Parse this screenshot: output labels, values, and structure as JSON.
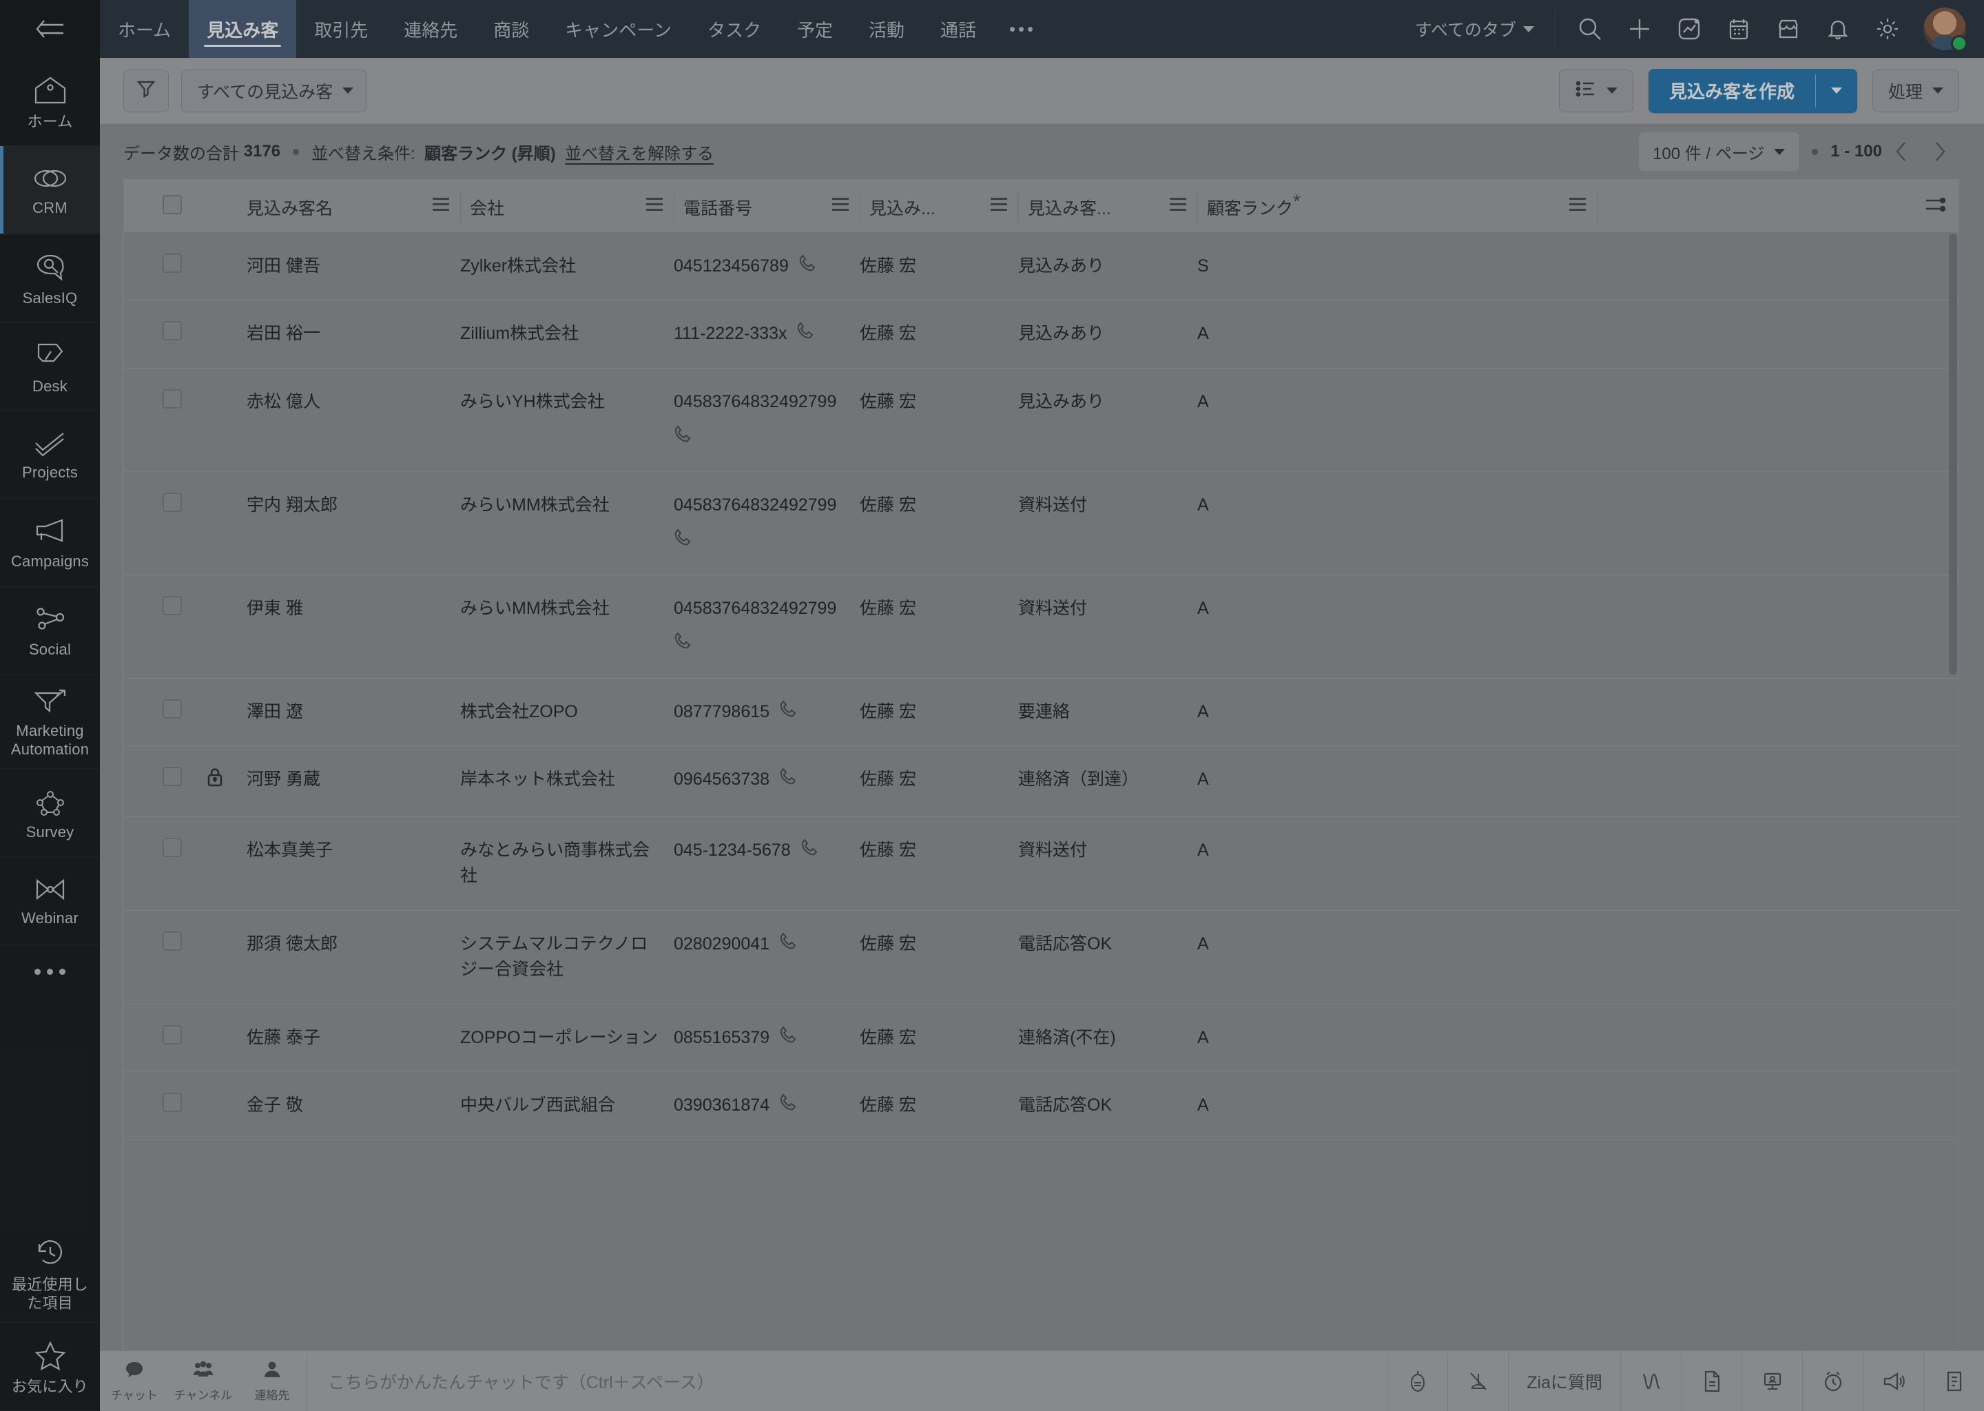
{
  "rail": {
    "collapse_icon": "collapse-arrow-icon",
    "items": [
      {
        "label": "ホーム",
        "icon": "home-icon",
        "active": false
      },
      {
        "label": "CRM",
        "icon": "crm-link-icon",
        "active": true
      },
      {
        "label": "SalesIQ",
        "icon": "salesiq-icon",
        "active": false
      },
      {
        "label": "Desk",
        "icon": "desk-icon",
        "active": false
      },
      {
        "label": "Projects",
        "icon": "projects-check-icon",
        "active": false
      },
      {
        "label": "Campaigns",
        "icon": "campaigns-megaphone-icon",
        "active": false
      },
      {
        "label": "Social",
        "icon": "social-share-icon",
        "active": false
      },
      {
        "label": "Marketing Automation",
        "icon": "marketing-funnel-icon",
        "active": false
      },
      {
        "label": "Survey",
        "icon": "survey-icon",
        "active": false
      },
      {
        "label": "Webinar",
        "icon": "webinar-icon",
        "active": false
      }
    ],
    "more_icon": "more-dots-icon",
    "bottom_items": [
      {
        "label": "最近使用した項目",
        "icon": "recent-clock-icon"
      },
      {
        "label": "お気に入り",
        "icon": "favorite-star-icon"
      }
    ]
  },
  "topnav": {
    "tabs": [
      {
        "label": "ホーム",
        "active": false
      },
      {
        "label": "見込み客",
        "active": true
      },
      {
        "label": "取引先",
        "active": false
      },
      {
        "label": "連絡先",
        "active": false
      },
      {
        "label": "商談",
        "active": false
      },
      {
        "label": "キャンペーン",
        "active": false
      },
      {
        "label": "タスク",
        "active": false
      },
      {
        "label": "予定",
        "active": false
      },
      {
        "label": "活動",
        "active": false
      },
      {
        "label": "通話",
        "active": false
      }
    ],
    "more_tabs_icon": "more-dots-icon",
    "all_tabs_label": "すべてのタブ",
    "icons": [
      "search-icon",
      "plus-icon",
      "analytics-icon",
      "calendar-icon",
      "marketplace-icon",
      "bell-icon",
      "gear-icon"
    ],
    "avatar": "user-avatar",
    "avatar_status": "online"
  },
  "actionbar": {
    "filter_icon": "filter-icon",
    "view_label": "すべての見込み客",
    "list_view_icon": "list-view-icon",
    "create_label": "見込み客を作成",
    "create_color": "#1a6fad",
    "actions_label": "処理"
  },
  "infobar": {
    "total_prefix": "データ数の合計",
    "total_count": "3176",
    "sort_prefix": "並べ替え条件:",
    "sort_field": "顧客ランク (昇順)",
    "clear_sort": "並べ替えを解除する",
    "per_page": "100 件 / ページ",
    "range": "1 - 100",
    "prev_icon": "chevron-left-icon",
    "next_icon": "chevron-right-icon"
  },
  "table": {
    "columns": [
      {
        "key": "select",
        "label": ""
      },
      {
        "key": "name",
        "label": "見込み客名"
      },
      {
        "key": "company",
        "label": "会社"
      },
      {
        "key": "phone",
        "label": "電話番号"
      },
      {
        "key": "owner",
        "label": "見込み..."
      },
      {
        "key": "status",
        "label": "見込み客..."
      },
      {
        "key": "rank",
        "label": "顧客ランク",
        "required": true
      }
    ],
    "column_settings_icon": "column-settings-icon",
    "rows": [
      {
        "name": "河田 健吾",
        "company": "Zylker株式会社",
        "phone": "045123456789",
        "owner": "佐藤 宏",
        "status": "見込みあり",
        "rank": "S",
        "locked": false
      },
      {
        "name": "岩田 裕一",
        "company": "Zillium株式会社",
        "phone": "111-2222-333x",
        "owner": "佐藤 宏",
        "status": "見込みあり",
        "rank": "A",
        "locked": false
      },
      {
        "name": "赤松 億人",
        "company": "みらいYH株式会社",
        "phone": "04583764832492799",
        "owner": "佐藤 宏",
        "status": "見込みあり",
        "rank": "A",
        "locked": false
      },
      {
        "name": "宇内 翔太郎",
        "company": "みらいMM株式会社",
        "phone": "04583764832492799",
        "owner": "佐藤 宏",
        "status": "資料送付",
        "rank": "A",
        "locked": false
      },
      {
        "name": "伊東 雅",
        "company": "みらいMM株式会社",
        "phone": "04583764832492799",
        "owner": "佐藤 宏",
        "status": "資料送付",
        "rank": "A",
        "locked": false
      },
      {
        "name": "澤田 遼",
        "company": "株式会社ZOPO",
        "phone": "0877798615",
        "owner": "佐藤 宏",
        "status": "要連絡",
        "rank": "A",
        "locked": false
      },
      {
        "name": "河野 勇蔵",
        "company": "岸本ネット株式会社",
        "phone": "0964563738",
        "owner": "佐藤 宏",
        "status": "連絡済（到達）",
        "rank": "A",
        "locked": true
      },
      {
        "name": "松本真美子",
        "company": "みなとみらい商事株式会社",
        "phone": "045-1234-5678",
        "owner": "佐藤 宏",
        "status": "資料送付",
        "rank": "A",
        "locked": false
      },
      {
        "name": "那須 徳太郎",
        "company": "システムマルコテクノロジー合資会社",
        "phone": "0280290041",
        "owner": "佐藤 宏",
        "status": "電話応答OK",
        "rank": "A",
        "locked": false
      },
      {
        "name": "佐藤 泰子",
        "company": "ZOPPOコーポレーション",
        "phone": "0855165379",
        "owner": "佐藤 宏",
        "status": "連絡済(不在)",
        "rank": "A",
        "locked": false
      },
      {
        "name": "金子 敬",
        "company": "中央バルブ西武組合",
        "phone": "0390361874",
        "owner": "佐藤 宏",
        "status": "電話応答OK",
        "rank": "A",
        "locked": false
      }
    ]
  },
  "bottombar": {
    "tiles": [
      {
        "label": "チャット",
        "icon": "chat-bubble-icon"
      },
      {
        "label": "チャンネル",
        "icon": "channel-group-icon"
      },
      {
        "label": "連絡先",
        "icon": "contact-person-icon"
      }
    ],
    "input_placeholder": "こちらがかんたんチャットです（Ctrl＋スペース）",
    "zia_label": "Ziaに質問",
    "right_icons": [
      "record-icon",
      "mute-icon",
      "zia-wave-icon",
      "document-icon",
      "presentation-icon",
      "reminder-clock-icon",
      "announce-icon",
      "notes-icon"
    ]
  }
}
